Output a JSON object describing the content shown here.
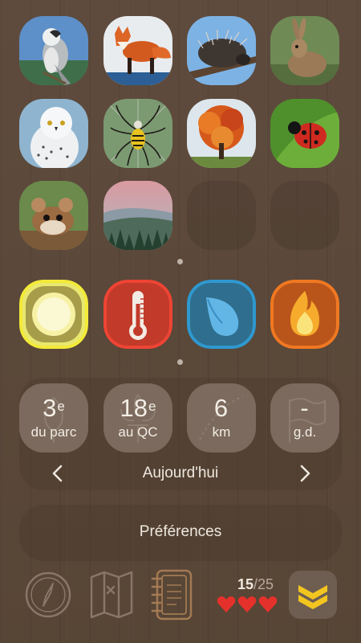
{
  "species": [
    {
      "name": "gray-jay-tile"
    },
    {
      "name": "red-fox-tile"
    },
    {
      "name": "porcupine-tile"
    },
    {
      "name": "hare-tile"
    },
    {
      "name": "snowy-owl-tile"
    },
    {
      "name": "garden-spider-tile"
    },
    {
      "name": "maple-tree-tile"
    },
    {
      "name": "ladybug-tile"
    },
    {
      "name": "mouse-tile"
    },
    {
      "name": "forest-landscape-tile"
    }
  ],
  "elements": [
    {
      "icon": "sun-icon",
      "color": "#f2e76b"
    },
    {
      "icon": "thermometer-icon",
      "color": "#e5412f"
    },
    {
      "icon": "water-drop-icon",
      "color": "#2f98cf"
    },
    {
      "icon": "flame-icon",
      "color": "#f07822"
    }
  ],
  "stats": [
    {
      "value": "3",
      "suffix": "e",
      "label": "du parc"
    },
    {
      "value": "18",
      "suffix": "e",
      "label": "au QC"
    },
    {
      "value": "6",
      "suffix": "",
      "label": "km"
    },
    {
      "value": "-",
      "suffix": "",
      "label": "g.d."
    }
  ],
  "period": {
    "label": "Aujourd'hui"
  },
  "preferences": {
    "label": "Préférences"
  },
  "progress": {
    "current": "15",
    "separator": "/",
    "total": "25",
    "hearts": 3
  }
}
